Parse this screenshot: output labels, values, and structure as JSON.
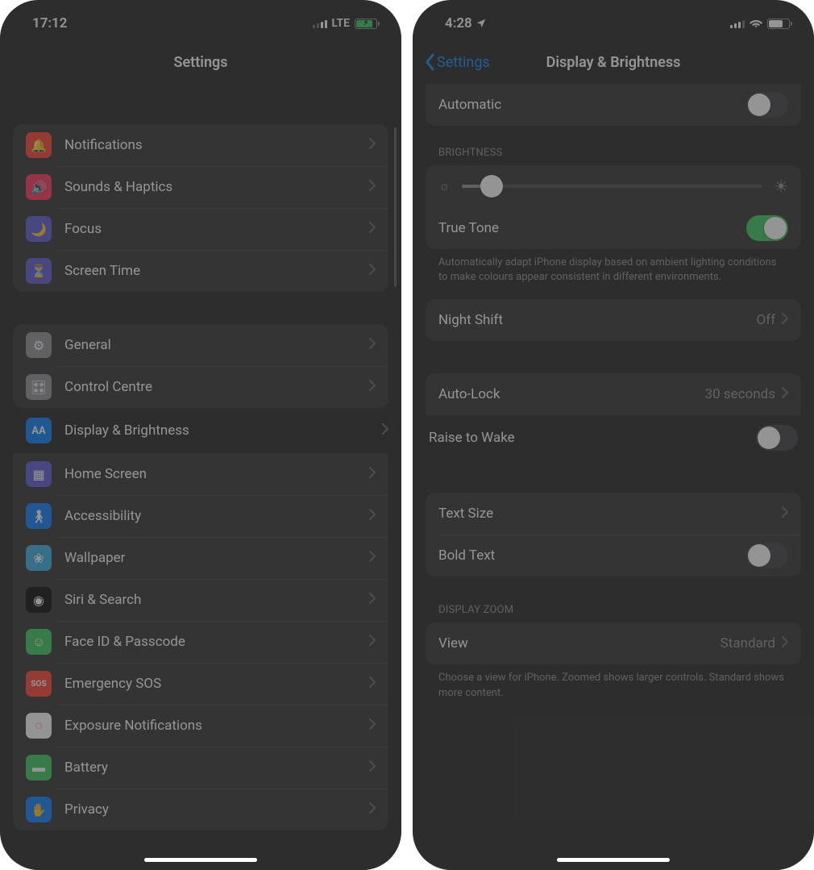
{
  "left": {
    "time": "17:12",
    "network": "LTE",
    "title": "Settings",
    "group1": [
      {
        "label": "Notifications",
        "icon": "bell-icon"
      },
      {
        "label": "Sounds & Haptics",
        "icon": "speaker-icon"
      },
      {
        "label": "Focus",
        "icon": "moon-icon"
      },
      {
        "label": "Screen Time",
        "icon": "hourglass-icon"
      }
    ],
    "group2": [
      {
        "label": "General",
        "icon": "gear-icon"
      },
      {
        "label": "Control Centre",
        "icon": "toggles-icon"
      },
      {
        "label": "Display & Brightness",
        "icon": "aa-icon",
        "highlight": true
      },
      {
        "label": "Home Screen",
        "icon": "grid-icon"
      },
      {
        "label": "Accessibility",
        "icon": "accessibility-icon"
      },
      {
        "label": "Wallpaper",
        "icon": "flower-icon"
      },
      {
        "label": "Siri & Search",
        "icon": "siri-icon"
      },
      {
        "label": "Face ID & Passcode",
        "icon": "faceid-icon"
      },
      {
        "label": "Emergency SOS",
        "icon": "sos-icon"
      },
      {
        "label": "Exposure Notifications",
        "icon": "exposure-icon"
      },
      {
        "label": "Battery",
        "icon": "battery-icon"
      },
      {
        "label": "Privacy",
        "icon": "hand-icon"
      }
    ]
  },
  "right": {
    "time": "4:28",
    "back": "Settings",
    "title": "Display & Brightness",
    "automatic_label": "Automatic",
    "brightness_header": "BRIGHTNESS",
    "truetone_label": "True Tone",
    "truetone_footer": "Automatically adapt iPhone display based on ambient lighting conditions to make colours appear consistent in different environments.",
    "nightshift_label": "Night Shift",
    "nightshift_value": "Off",
    "autolock_label": "Auto-Lock",
    "autolock_value": "30 seconds",
    "raise_label": "Raise to Wake",
    "textsize_label": "Text Size",
    "boldtext_label": "Bold Text",
    "zoom_header": "DISPLAY ZOOM",
    "view_label": "View",
    "view_value": "Standard",
    "zoom_footer": "Choose a view for iPhone. Zoomed shows larger controls. Standard shows more content."
  }
}
